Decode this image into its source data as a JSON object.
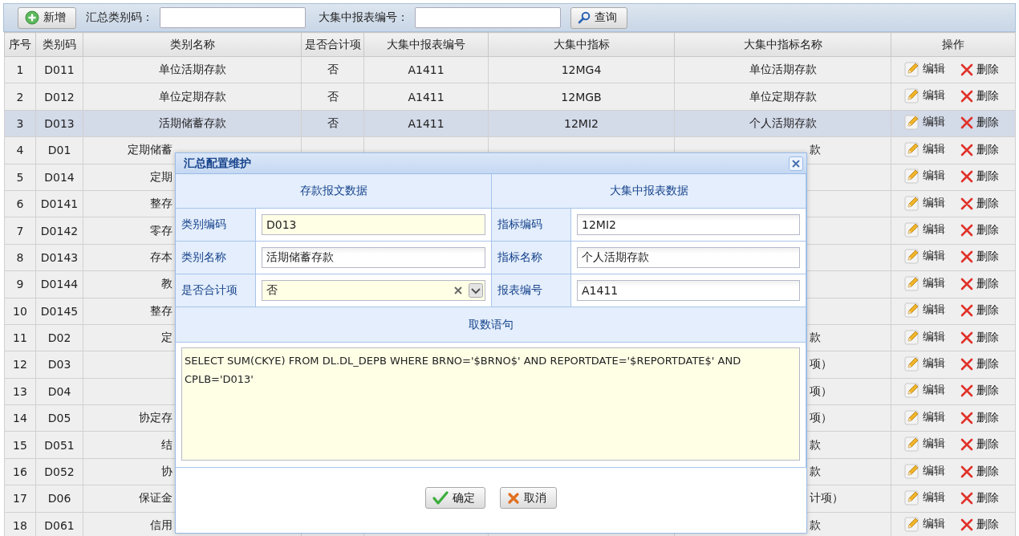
{
  "toolbar": {
    "add_button": "新增",
    "filters": [
      {
        "label": "汇总类别码："
      },
      {
        "label": "大集中报表编号："
      }
    ],
    "search_button": "查询"
  },
  "table": {
    "columns": [
      "序号",
      "类别码",
      "类别名称",
      "是否合计项",
      "大集中报表编号",
      "大集中指标",
      "大集中指标名称",
      "操作"
    ],
    "rows": [
      {
        "kind": "full",
        "seq": "1",
        "code": "D011",
        "name": "单位活期存款",
        "total": "否",
        "report": "A1411",
        "indicator": "12MG4",
        "indicator_name": "单位活期存款",
        "edit": "编辑",
        "delete": "删除",
        "selected": false
      },
      {
        "kind": "full",
        "seq": "2",
        "code": "D012",
        "name": "单位定期存款",
        "total": "否",
        "report": "A1411",
        "indicator": "12MGB",
        "indicator_name": "单位定期存款",
        "edit": "编辑",
        "delete": "删除",
        "selected": false
      },
      {
        "kind": "full",
        "seq": "3",
        "code": "D013",
        "name": "活期储蓄存款",
        "total": "否",
        "report": "A1411",
        "indicator": "12MI2",
        "indicator_name": "个人活期存款",
        "edit": "编辑",
        "delete": "删除",
        "selected": true
      },
      {
        "kind": "covered",
        "seq": "4",
        "code": "D01",
        "name": "定期储蓄",
        "indicator_name": "款",
        "edit": "编辑",
        "delete": "删除",
        "selected": false
      },
      {
        "kind": "covered",
        "seq": "5",
        "code": "D014",
        "name": "定期",
        "edit": "编辑",
        "delete": "删除",
        "selected": false
      },
      {
        "kind": "covered",
        "seq": "6",
        "code": "D0141",
        "name": "整存",
        "edit": "编辑",
        "delete": "删除",
        "selected": false
      },
      {
        "kind": "covered",
        "seq": "7",
        "code": "D0142",
        "name": "零存",
        "edit": "编辑",
        "delete": "删除",
        "selected": false
      },
      {
        "kind": "covered",
        "seq": "8",
        "code": "D0143",
        "name": "存本",
        "edit": "编辑",
        "delete": "删除",
        "selected": false
      },
      {
        "kind": "covered",
        "seq": "9",
        "code": "D0144",
        "name": "教",
        "edit": "编辑",
        "delete": "删除",
        "selected": false
      },
      {
        "kind": "covered",
        "seq": "10",
        "code": "D0145",
        "name": "整存",
        "edit": "编辑",
        "delete": "删除",
        "selected": false
      },
      {
        "kind": "covered",
        "seq": "11",
        "code": "D02",
        "name": "定",
        "indicator_name": "款",
        "edit": "编辑",
        "delete": "删除",
        "selected": false
      },
      {
        "kind": "covered",
        "seq": "12",
        "code": "D03",
        "indicator_name": "项）",
        "edit": "编辑",
        "delete": "删除",
        "selected": false
      },
      {
        "kind": "covered",
        "seq": "13",
        "code": "D04",
        "indicator_name": "项）",
        "edit": "编辑",
        "delete": "删除",
        "selected": false
      },
      {
        "kind": "covered",
        "seq": "14",
        "code": "D05",
        "name": "协定存",
        "indicator_name": "项）",
        "edit": "编辑",
        "delete": "删除",
        "selected": false
      },
      {
        "kind": "covered",
        "seq": "15",
        "code": "D051",
        "name": "结",
        "indicator_name": "款",
        "edit": "编辑",
        "delete": "删除",
        "selected": false
      },
      {
        "kind": "covered",
        "seq": "16",
        "code": "D052",
        "name": "协",
        "indicator_name": "款",
        "edit": "编辑",
        "delete": "删除",
        "selected": false
      },
      {
        "kind": "covered",
        "seq": "17",
        "code": "D06",
        "name": "保证金",
        "indicator_name": "计项）",
        "edit": "编辑",
        "delete": "删除",
        "selected": false
      },
      {
        "kind": "covered",
        "seq": "18",
        "code": "D061",
        "name": "信用",
        "indicator_name": "款",
        "edit": "编辑",
        "delete": "删除",
        "selected": false
      }
    ]
  },
  "dialog": {
    "title": "汇总配置维护",
    "sections": [
      "存款报文数据",
      "大集中报表数据"
    ],
    "rows": [
      [
        {
          "label": "类别编码",
          "kind": "text",
          "value": "D013",
          "highlighted": true
        },
        {
          "label": "指标编码",
          "kind": "text",
          "value": "12MI2",
          "highlighted": false
        }
      ],
      [
        {
          "label": "类别名称",
          "kind": "text",
          "value": "活期储蓄存款",
          "highlighted": false
        },
        {
          "label": "指标名称",
          "kind": "text",
          "value": "个人活期存款",
          "highlighted": false
        }
      ],
      [
        {
          "label": "是否合计项",
          "kind": "combo",
          "value": "否",
          "highlighted": true
        },
        {
          "label": "报表编号",
          "kind": "text",
          "value": "A1411",
          "highlighted": false
        }
      ]
    ],
    "sql_label": "取数语句",
    "sql": "SELECT SUM(CKYE) FROM DL.DL_DEPB WHERE BRNO='$BRNO$' AND REPORTDATE='$REPORTDATE$' AND CPLB='D013'",
    "ok_button": "确定",
    "cancel_button": "取消"
  }
}
